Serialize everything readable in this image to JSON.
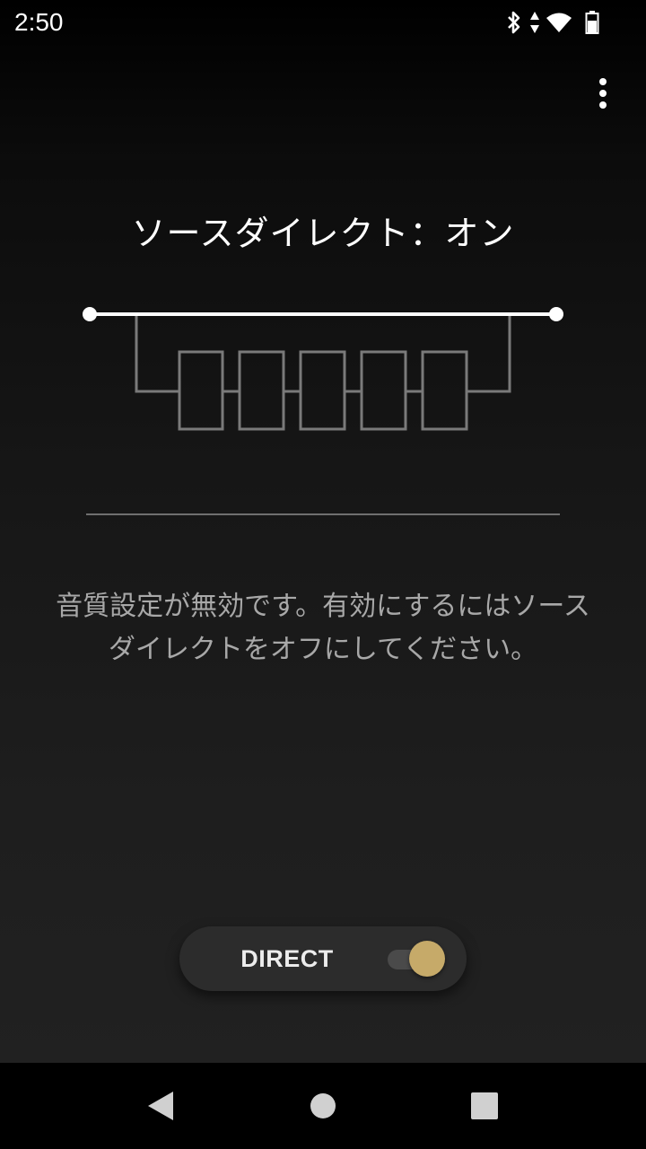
{
  "status_bar": {
    "time": "2:50",
    "icons": [
      "bluetooth-icon",
      "data-arrows-icon",
      "wifi-icon",
      "battery-icon"
    ]
  },
  "app_bar": {
    "overflow_icon": "more-vert-icon"
  },
  "main": {
    "title": "ソースダイレクト：オン",
    "message_line1": "音質設定が無効です。有効にするにはソース",
    "message_line2": "ダイレクトをオフにしてください。"
  },
  "direct_toggle": {
    "label": "DIRECT",
    "state": "on",
    "accent_color": "#c6aa69"
  },
  "nav_bar": {
    "buttons": [
      "back-icon",
      "home-icon",
      "recents-icon"
    ]
  }
}
